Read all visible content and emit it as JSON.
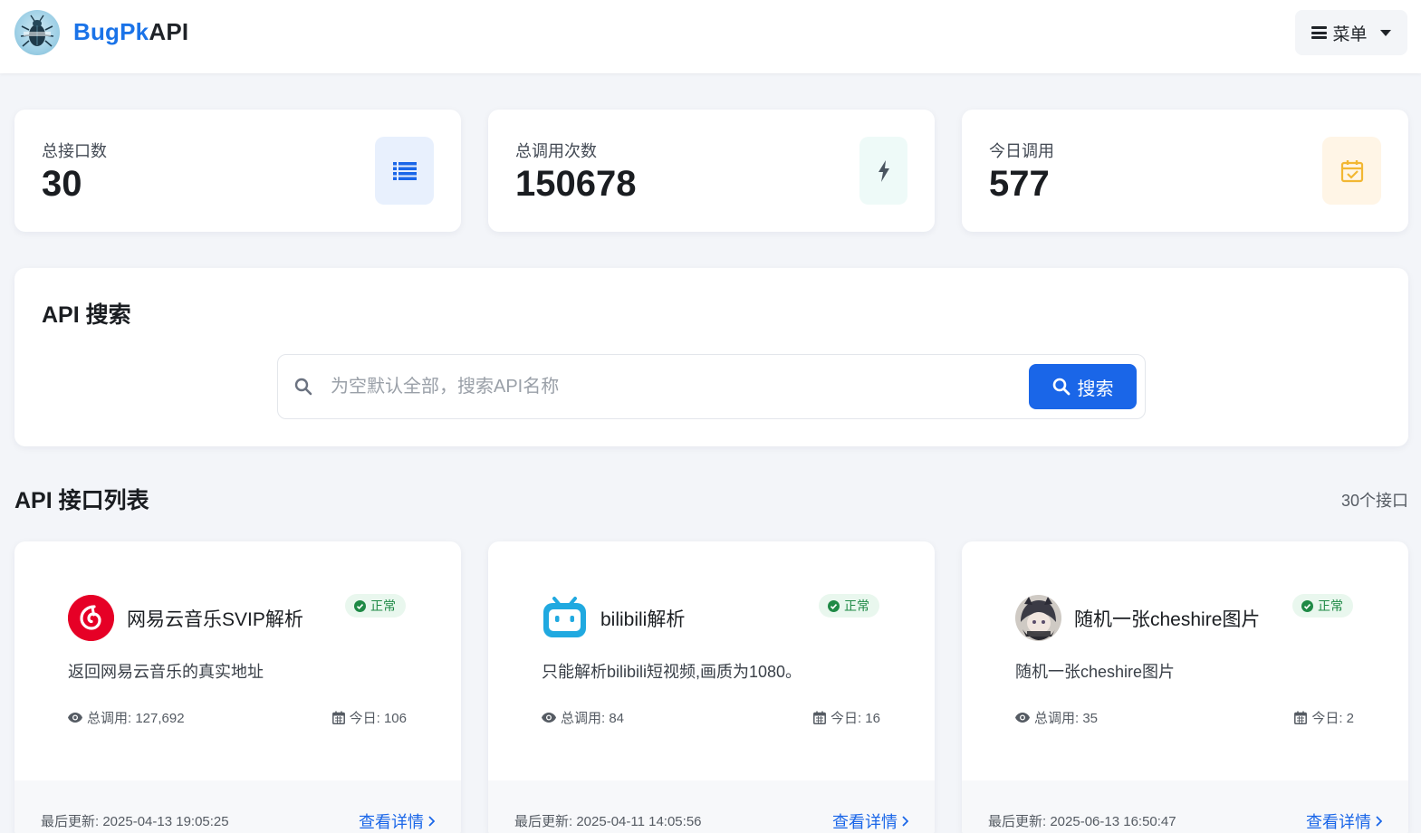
{
  "header": {
    "brand_part1": "BugPk",
    "brand_part2": "API",
    "menu_label": "菜单"
  },
  "stats": [
    {
      "label": "总接口数",
      "value": "30",
      "icon": "list-icon",
      "accent": "#1a66e8",
      "bg": "#e8f0fd"
    },
    {
      "label": "总调用次数",
      "value": "150678",
      "icon": "bolt-icon",
      "accent": "#4a5560",
      "bg": "#eefaf8"
    },
    {
      "label": "今日调用",
      "value": "577",
      "icon": "calendar-check-icon",
      "accent": "#f2b733",
      "bg": "#fff5e6"
    }
  ],
  "search": {
    "title": "API 搜索",
    "placeholder": "为空默认全部，搜索API名称",
    "button_label": "搜索"
  },
  "list": {
    "title": "API 接口列表",
    "count": "30个接口"
  },
  "apis": [
    {
      "name": "网易云音乐SVIP解析",
      "status": "正常",
      "desc": "返回网易云音乐的真实地址",
      "total": "总调用: 127,692",
      "today": "今日: 106",
      "updated": "最后更新: 2025-04-13 19:05:25",
      "detail": "查看详情",
      "icon": "netease-music-icon"
    },
    {
      "name": "bilibili解析",
      "status": "正常",
      "desc": "只能解析bilibili短视频,画质为1080。",
      "total": "总调用: 84",
      "today": "今日: 16",
      "updated": "最后更新: 2025-04-11 14:05:56",
      "detail": "查看详情",
      "icon": "bilibili-icon"
    },
    {
      "name": "随机一张cheshire图片",
      "status": "正常",
      "desc": "随机一张cheshire图片",
      "total": "总调用: 35",
      "today": "今日: 2",
      "updated": "最后更新: 2025-06-13 16:50:47",
      "detail": "查看详情",
      "icon": "cheshire-avatar-icon"
    }
  ],
  "colors": {
    "primary": "#1a66e8",
    "status_ok": "#1f8a46",
    "status_ok_bg": "#e9f7ee",
    "page_bg": "#f3f5f9"
  }
}
